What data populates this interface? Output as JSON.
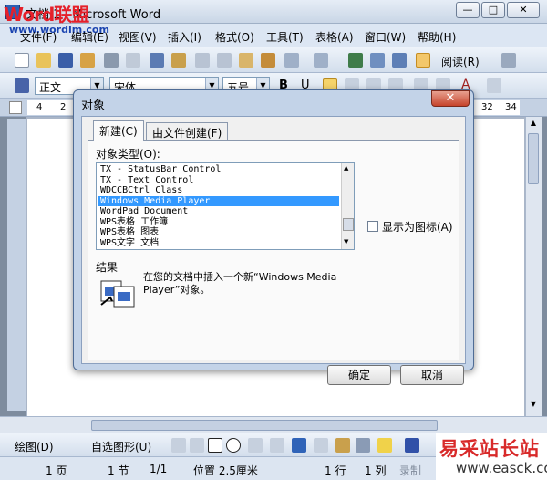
{
  "window": {
    "title": "文档 1 - Microsoft Word",
    "logo": "Word联盟",
    "logo_url": "www.wordlm.com",
    "min": "—",
    "max": "□",
    "close": "✕"
  },
  "menubar": {
    "items": [
      "文件(F)",
      "编辑(E)",
      "视图(V)",
      "插入(I)",
      "格式(O)",
      "工具(T)",
      "表格(A)",
      "窗口(W)",
      "帮助(H)"
    ]
  },
  "toolbar_standard": {
    "read_label": "阅读(R)"
  },
  "toolbar_format": {
    "style": "正文",
    "font": "宋体",
    "size": "五号",
    "bold": "B",
    "underline": "U",
    "font_color": "A"
  },
  "ruler": {
    "numbers": [
      "4",
      "2",
      "32",
      "34"
    ]
  },
  "dialog": {
    "title": "对象",
    "close": "✕",
    "tabs": [
      "新建(C)",
      "由文件创建(F)"
    ],
    "object_type_label": "对象类型(O):",
    "object_types": [
      "TX - StatusBar Control",
      "TX - Text Control",
      "WDCCBCtrl Class",
      "Windows Media Player",
      "WordPad Document",
      "WPS表格 工作簿",
      "WPS表格 图表",
      "WPS文字 文档"
    ],
    "selected_index": 3,
    "display_as_icon": "显示为图标(A)",
    "result_label": "结果",
    "result_text": "在您的文档中插入一个新“Windows Media Player”对象。",
    "ok": "确定",
    "cancel": "取消"
  },
  "drawbar": {
    "draw": "绘图(D)",
    "autoshapes": "自选图形(U)"
  },
  "statusbar": {
    "page": "1 页",
    "section": "1 节",
    "page_of": "1/1",
    "position": "位置 2.5厘米",
    "line": "1 行",
    "col": "1 列",
    "rec": "录制",
    "rev": "修"
  },
  "watermark": {
    "cn": "易采站长站",
    "url": "www.easck.com"
  },
  "colors": {
    "accent": "#3399ff",
    "title_bar": "#c9d6e6",
    "close_red": "#c6432b"
  }
}
